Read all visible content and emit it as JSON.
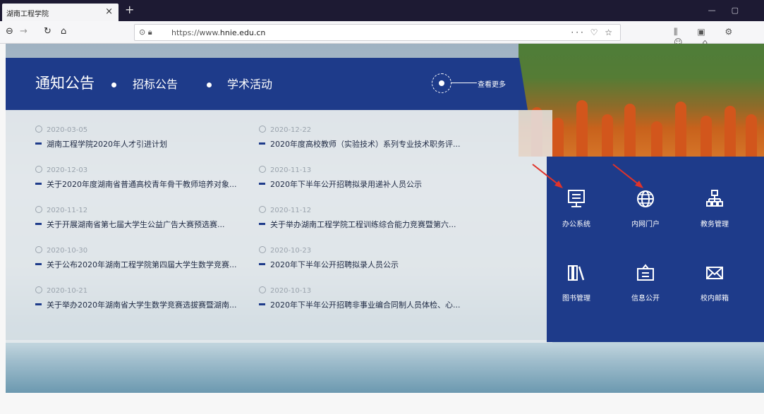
{
  "browser": {
    "tab_title": "湖南工程学院",
    "tab_close": "×",
    "new_tab": "+",
    "url_prefix": "https://www.",
    "url_domain": "hnie.edu.cn",
    "url_right_icons": "··· ♡ ☆"
  },
  "news": {
    "tabs": [
      "通知公告",
      "招标公告",
      "学术活动"
    ],
    "more_label": "查看更多",
    "items": [
      {
        "date": "2020-03-05",
        "title": "湖南工程学院2020年人才引进计划"
      },
      {
        "date": "2020-12-22",
        "title": "2020年度高校教师（实验技术）系列专业技术职务评..."
      },
      {
        "date": "2020-12-03",
        "title": "关于2020年度湖南省普通高校青年骨干教师培养对象..."
      },
      {
        "date": "2020-11-13",
        "title": "2020年下半年公开招聘拟录用递补人员公示"
      },
      {
        "date": "2020-11-12",
        "title": "关于开展湖南省第七届大学生公益广告大赛预选赛..."
      },
      {
        "date": "2020-11-12",
        "title": "关于举办湖南工程学院工程训练综合能力竞赛暨第六..."
      },
      {
        "date": "2020-10-30",
        "title": "关于公布2020年湖南工程学院第四届大学生数学竞赛..."
      },
      {
        "date": "2020-10-23",
        "title": "2020年下半年公开招聘拟录人员公示"
      },
      {
        "date": "2020-10-21",
        "title": "关于举办2020年湖南省大学生数学竞赛选拔赛暨湖南..."
      },
      {
        "date": "2020-10-13",
        "title": "2020年下半年公开招聘非事业编合同制人员体检、心..."
      }
    ]
  },
  "systems": [
    {
      "label": "办公系统",
      "icon": "monitor-icon"
    },
    {
      "label": "内网门户",
      "icon": "globe-icon"
    },
    {
      "label": "教务管理",
      "icon": "org-chart-icon"
    },
    {
      "label": "图书管理",
      "icon": "books-icon"
    },
    {
      "label": "信息公开",
      "icon": "briefcase-icon"
    },
    {
      "label": "校内邮箱",
      "icon": "mail-icon"
    }
  ],
  "colors": {
    "primary": "#1e3b8a",
    "annotation_arrow": "#e0332a"
  }
}
